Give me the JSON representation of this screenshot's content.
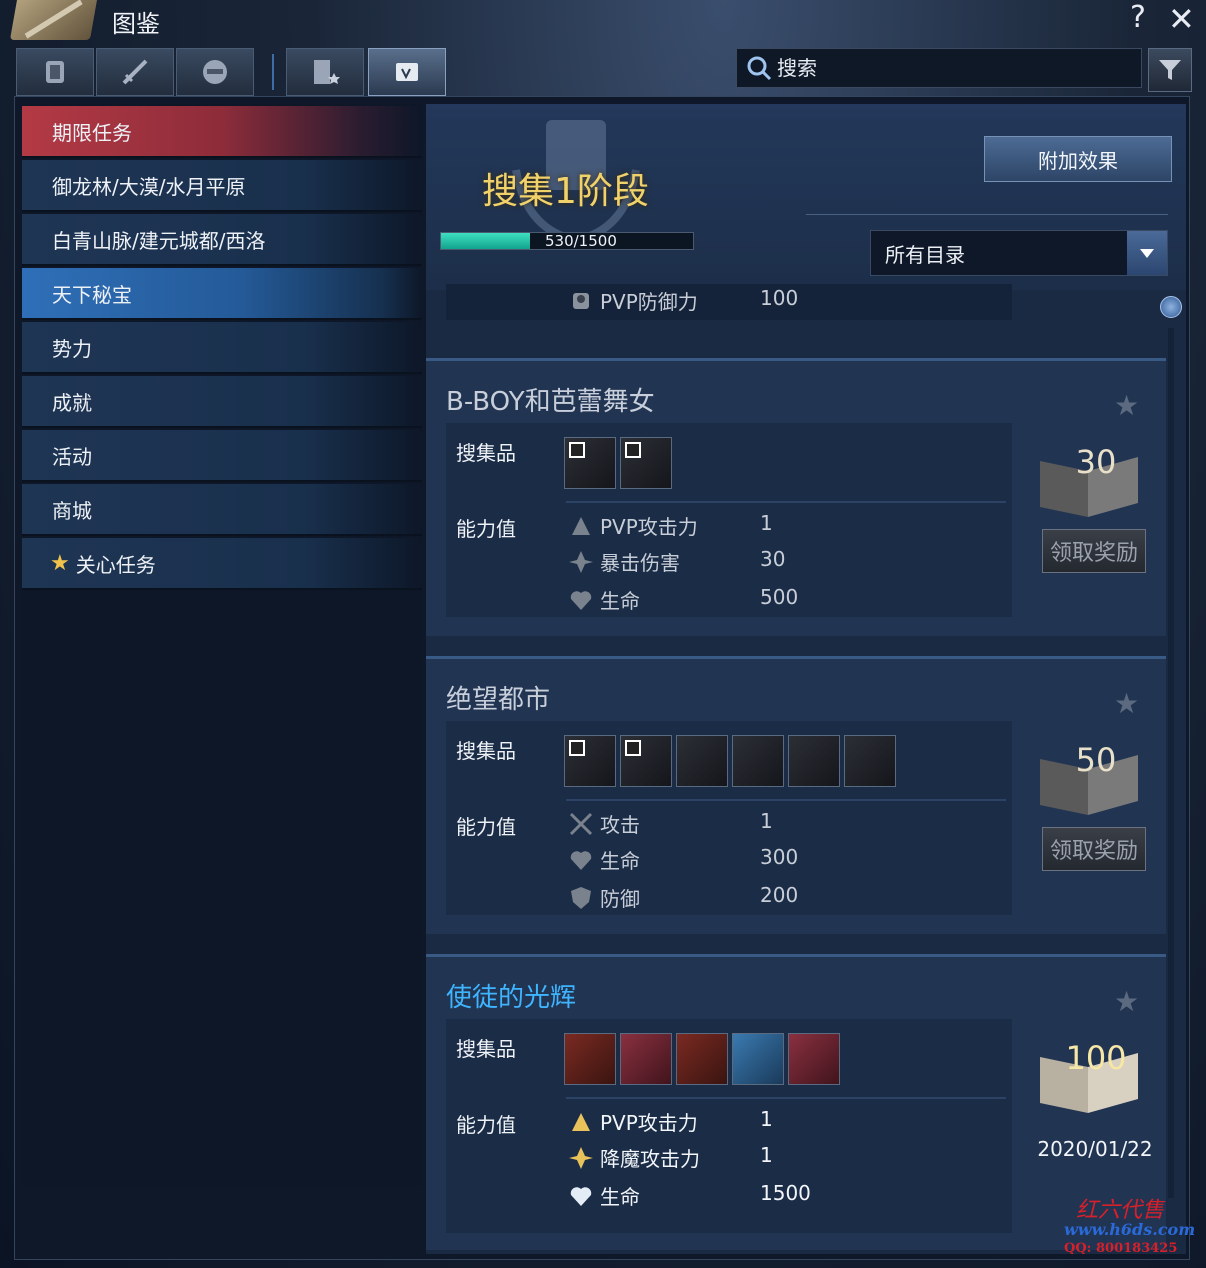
{
  "window": {
    "title": "图鉴",
    "help": "?",
    "close": "✕"
  },
  "tabs": [
    {
      "icon": "armor-icon"
    },
    {
      "icon": "sword-icon"
    },
    {
      "icon": "helmet-icon"
    },
    {
      "icon": "card-icon"
    },
    {
      "icon": "scroll-icon",
      "active": true
    }
  ],
  "search": {
    "placeholder": "搜索"
  },
  "sidebar": {
    "items": [
      {
        "label": "期限任务"
      },
      {
        "label": "御龙林/大漠/水月平原"
      },
      {
        "label": "白青山脉/建元城都/西洛"
      },
      {
        "label": "天下秘宝"
      },
      {
        "label": "势力"
      },
      {
        "label": "成就"
      },
      {
        "label": "活动"
      },
      {
        "label": "商城"
      },
      {
        "label": "关心任务"
      }
    ]
  },
  "header": {
    "stage_title": "搜集1阶段",
    "progress_text": "530/1500",
    "progress_fraction": 0.353,
    "extra_button": "附加效果",
    "category_select": "所有目录"
  },
  "partial_row": {
    "name": "PVP防御力",
    "value": "100"
  },
  "cards": [
    {
      "title": "B-BOY和芭蕾舞女",
      "items_label": "搜集品",
      "stats_label": "能力值",
      "stats": [
        {
          "name": "PVP攻击力",
          "value": "1"
        },
        {
          "name": "暴击伤害",
          "value": "30"
        },
        {
          "name": "生命",
          "value": "500"
        }
      ],
      "reward": "30",
      "claim": "领取奖励"
    },
    {
      "title": "绝望都市",
      "items_label": "搜集品",
      "stats_label": "能力值",
      "stats": [
        {
          "name": "攻击",
          "value": "1"
        },
        {
          "name": "生命",
          "value": "300"
        },
        {
          "name": "防御",
          "value": "200"
        }
      ],
      "reward": "50",
      "claim": "领取奖励"
    },
    {
      "title": "使徒的光辉",
      "items_label": "搜集品",
      "stats_label": "能力值",
      "stats": [
        {
          "name": "PVP攻击力",
          "value": "1"
        },
        {
          "name": "降魔攻击力",
          "value": "1"
        },
        {
          "name": "生命",
          "value": "1500"
        }
      ],
      "reward": "100",
      "date": "2020/01/22"
    }
  ],
  "watermark": {
    "line1": "红六代售",
    "line2": "www.h6ds.com",
    "line3": "QQ: 800183425"
  },
  "colors": {
    "accent_gold": "#f1d26a",
    "accent_blue": "#3fb4ff",
    "progress": "#3ee0c2",
    "active_red": "#b33a45"
  }
}
